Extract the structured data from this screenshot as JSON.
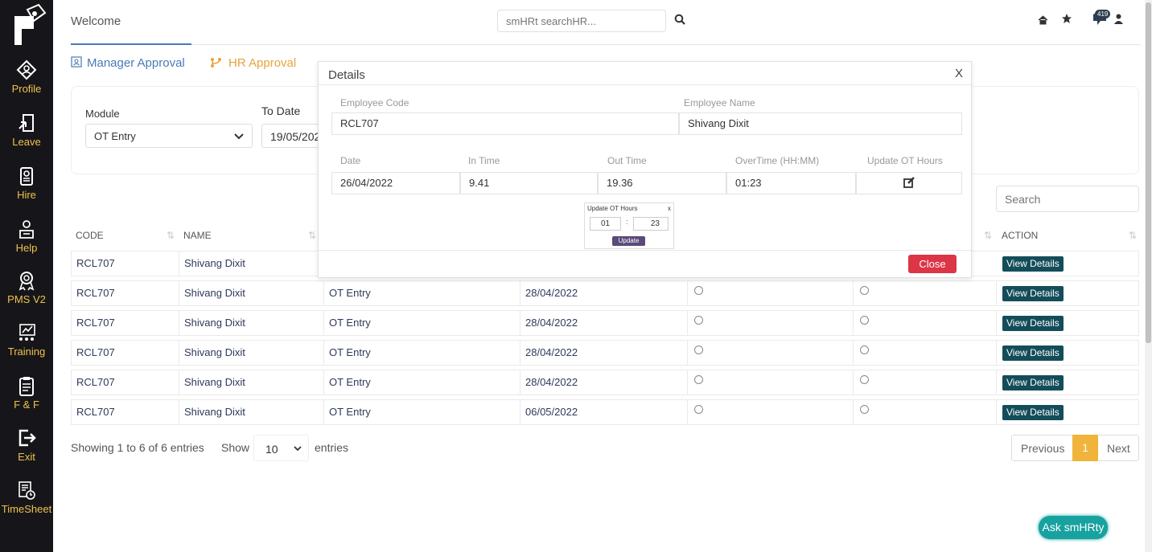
{
  "sidebar": {
    "items": [
      {
        "label": "Profile",
        "icon": "profile-icon"
      },
      {
        "label": "Leave",
        "icon": "leave-icon"
      },
      {
        "label": "Hire",
        "icon": "hire-icon"
      },
      {
        "label": "Help",
        "icon": "help-icon"
      },
      {
        "label": "PMS V2",
        "icon": "award-icon"
      },
      {
        "label": "Training",
        "icon": "training-icon"
      },
      {
        "label": "F & F",
        "icon": "clipboard-icon"
      },
      {
        "label": "Exit",
        "icon": "exit-icon"
      },
      {
        "label": "TimeSheet",
        "icon": "timesheet-icon"
      }
    ],
    "label_color": "#f0c24a"
  },
  "header": {
    "title": "Welcome",
    "search_placeholder": "smHRt searchHR...",
    "notification_count": "419"
  },
  "tabs": [
    {
      "label": "Manager Approval",
      "icon": "user-card-icon",
      "color": "#4a7ab5"
    },
    {
      "label": "HR Approval",
      "icon": "branch-icon",
      "color": "#e8a33d"
    }
  ],
  "filters": {
    "module_label": "Module",
    "module_value": "OT Entry",
    "to_date_label": "To Date",
    "to_date_value": "19/05/202"
  },
  "table": {
    "search_placeholder": "Search",
    "columns": [
      "CODE",
      "NAME",
      "ACTION"
    ],
    "action_label": "View Details",
    "rows": [
      {
        "code": "RCL707",
        "name": "Shivang Dixit",
        "module": "",
        "date": ""
      },
      {
        "code": "RCL707",
        "name": "Shivang Dixit",
        "module": "OT Entry",
        "date": "28/04/2022"
      },
      {
        "code": "RCL707",
        "name": "Shivang Dixit",
        "module": "OT Entry",
        "date": "28/04/2022"
      },
      {
        "code": "RCL707",
        "name": "Shivang Dixit",
        "module": "OT Entry",
        "date": "28/04/2022"
      },
      {
        "code": "RCL707",
        "name": "Shivang Dixit",
        "module": "OT Entry",
        "date": "28/04/2022"
      },
      {
        "code": "RCL707",
        "name": "Shivang Dixit",
        "module": "OT Entry",
        "date": "06/05/2022"
      }
    ]
  },
  "footer": {
    "showing": "Showing 1 to 6 of 6 entries",
    "show_label": "Show",
    "page_size": "10",
    "entries_label": "entries",
    "previous": "Previous",
    "current_page": "1",
    "next": "Next"
  },
  "ask_button": "Ask smHRty",
  "modal": {
    "title": "Details",
    "close_x": "X",
    "employee_code_label": "Employee Code",
    "employee_code": "RCL707",
    "employee_name_label": "Employee Name",
    "employee_name": "Shivang Dixit",
    "date_label": "Date",
    "in_time_label": "In Time",
    "out_time_label": "Out Time",
    "overtime_label": "OverTime (HH:MM)",
    "update_ot_label": "Update OT Hours",
    "date": "26/04/2022",
    "in_time": "9.41",
    "out_time": "19.36",
    "overtime": "01:23",
    "close_button": "Close",
    "mini_popup": {
      "title": "Update OT Hours",
      "close": "x",
      "hours": "01",
      "separator": ":",
      "minutes": "23",
      "update_button": "Update"
    }
  }
}
